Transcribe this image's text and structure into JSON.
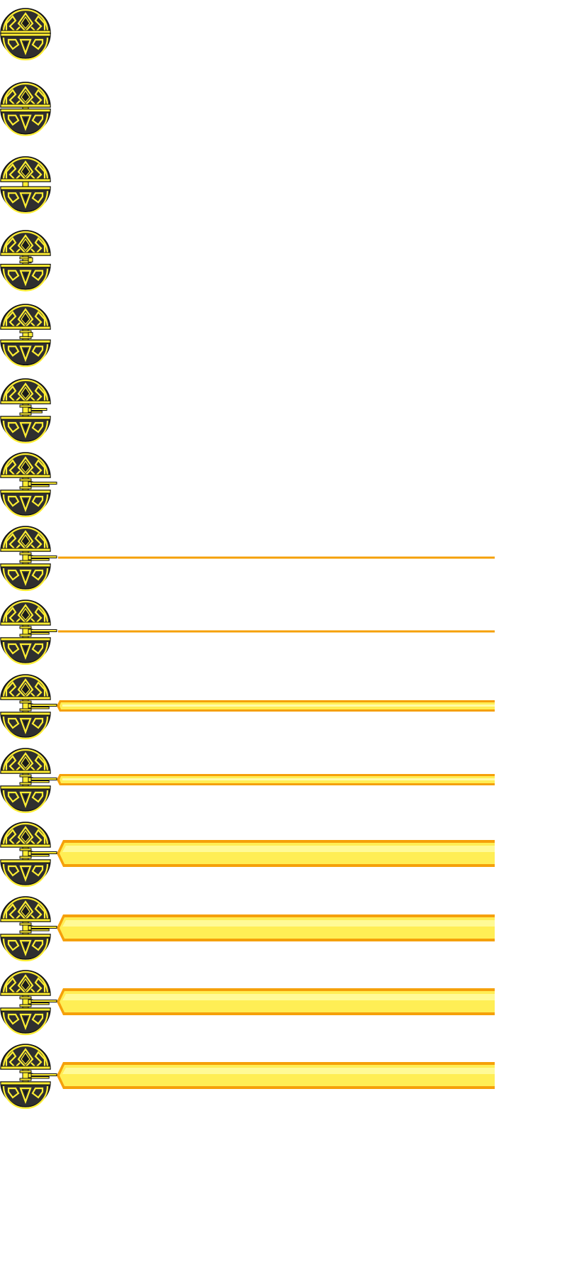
{
  "sprite_sheet": {
    "sprite": "sphere-laser-turret",
    "icons": [
      "sphere-turret-icon",
      "laser-beam-icon"
    ],
    "colors": {
      "background": "#ffffff",
      "shell_fill": "#2f2f2f",
      "shell_dark": "#1a1a1a",
      "pattern": "#ffee33",
      "outline": "#111111",
      "beam_outer": "#f5a00a",
      "beam_inner": "#ffee55",
      "beam_core": "#fffca8"
    },
    "frames": [
      {
        "frame": 1,
        "open": 0.0,
        "barrel": 0.0,
        "beam": "none"
      },
      {
        "frame": 2,
        "open": 0.15,
        "barrel": 0.0,
        "beam": "none"
      },
      {
        "frame": 3,
        "open": 0.4,
        "barrel": 0.0,
        "beam": "none"
      },
      {
        "frame": 4,
        "open": 0.7,
        "barrel": 0.0,
        "beam": "none"
      },
      {
        "frame": 5,
        "open": 0.85,
        "barrel": 0.0,
        "beam": "none"
      },
      {
        "frame": 6,
        "open": 1.0,
        "barrel": 0.5,
        "beam": "none"
      },
      {
        "frame": 7,
        "open": 1.0,
        "barrel": 1.0,
        "beam": "none"
      },
      {
        "frame": 8,
        "open": 1.0,
        "barrel": 1.0,
        "beam": "line"
      },
      {
        "frame": 9,
        "open": 1.0,
        "barrel": 1.0,
        "beam": "line"
      },
      {
        "frame": 10,
        "open": 1.0,
        "barrel": 1.0,
        "beam": "thin"
      },
      {
        "frame": 11,
        "open": 1.0,
        "barrel": 1.0,
        "beam": "thin"
      },
      {
        "frame": 12,
        "open": 1.0,
        "barrel": 1.0,
        "beam": "wide"
      },
      {
        "frame": 13,
        "open": 1.0,
        "barrel": 1.0,
        "beam": "wide"
      },
      {
        "frame": 14,
        "open": 1.0,
        "barrel": 1.0,
        "beam": "wide"
      },
      {
        "frame": 15,
        "open": 1.0,
        "barrel": 1.0,
        "beam": "wide"
      }
    ]
  }
}
